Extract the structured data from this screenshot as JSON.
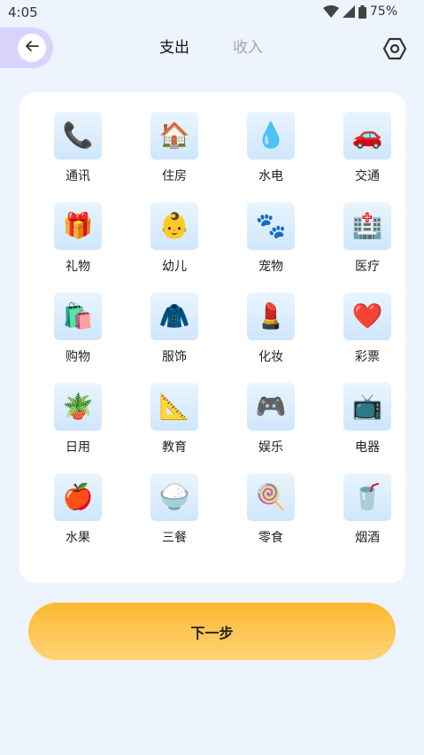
{
  "status_bar": {
    "time": "4:05",
    "battery": "75%",
    "icons": [
      "wifi-icon",
      "cell-signal-icon",
      "battery-icon"
    ]
  },
  "header": {
    "back_icon": "arrow-left-icon",
    "tabs": [
      {
        "label": "支出",
        "selected": true
      },
      {
        "label": "收入",
        "selected": false
      }
    ],
    "settings_icon": "hexagon-settings-icon"
  },
  "categories": [
    {
      "label": "通讯",
      "icon": "📞"
    },
    {
      "label": "住房",
      "icon": "🏠"
    },
    {
      "label": "水电",
      "icon": "💧"
    },
    {
      "label": "交通",
      "icon": "🚗"
    },
    {
      "label": "礼物",
      "icon": "🎁"
    },
    {
      "label": "幼儿",
      "icon": "👶"
    },
    {
      "label": "宠物",
      "icon": "🐾"
    },
    {
      "label": "医疗",
      "icon": "🏥"
    },
    {
      "label": "购物",
      "icon": "🛍️"
    },
    {
      "label": "服饰",
      "icon": "🧥"
    },
    {
      "label": "化妆",
      "icon": "💄"
    },
    {
      "label": "彩票",
      "icon": "❤️"
    },
    {
      "label": "日用",
      "icon": "🪴"
    },
    {
      "label": "教育",
      "icon": "📐"
    },
    {
      "label": "娱乐",
      "icon": "🎮"
    },
    {
      "label": "电器",
      "icon": "📺"
    },
    {
      "label": "水果",
      "icon": "🍎"
    },
    {
      "label": "三餐",
      "icon": "🍚"
    },
    {
      "label": "零食",
      "icon": "🍭"
    },
    {
      "label": "烟酒",
      "icon": "🥤"
    }
  ],
  "next_button": {
    "label": "下一步"
  },
  "colors": {
    "background": "#eef4fd",
    "card": "#ffffff",
    "back_pill": "#d8d3fb",
    "button_top": "#fdb732",
    "button_bottom": "#fdd476",
    "tab_inactive": "#a6a6a6"
  }
}
